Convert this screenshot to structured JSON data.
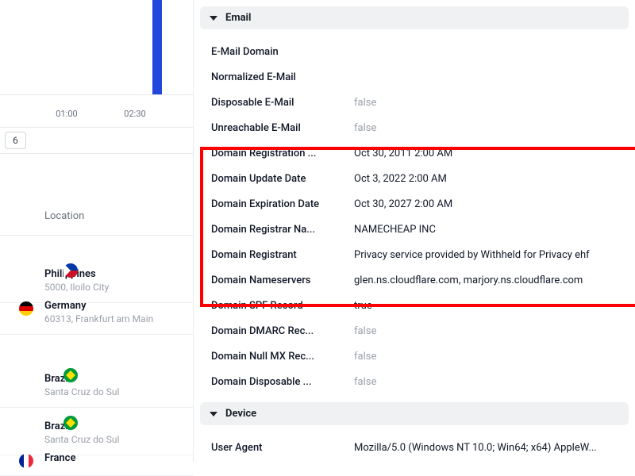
{
  "chart": {
    "timeLabels": [
      "01:00",
      "02:30"
    ],
    "badge": "6"
  },
  "leftTable": {
    "header": "Location",
    "items": [
      {
        "country": "Philippines",
        "city": "5000, Iloilo City",
        "flag": "ph"
      },
      {
        "country": "Germany",
        "city": "60313, Frankfurt am Main",
        "flag": "de"
      },
      {
        "country": "Brazil",
        "city": "Santa Cruz do Sul",
        "flag": "br"
      },
      {
        "country": "Brazil",
        "city": "Santa Cruz do Sul",
        "flag": "br"
      },
      {
        "country": "France",
        "city": "",
        "flag": "fr"
      }
    ]
  },
  "emailSection": {
    "title": "Email",
    "rows": [
      {
        "label": "E-Mail Domain",
        "value": ""
      },
      {
        "label": "Normalized E-Mail",
        "value": ""
      },
      {
        "label": "Disposable E-Mail",
        "value": "false",
        "muted": true
      },
      {
        "label": "Unreachable E-Mail",
        "value": "false",
        "muted": true
      },
      {
        "label": "Domain Registration ...",
        "value": "Oct 30, 2011 2:00 AM"
      },
      {
        "label": "Domain Update Date",
        "value": "Oct 3, 2022 2:00 AM"
      },
      {
        "label": "Domain Expiration Date",
        "value": "Oct 30, 2027 2:00 AM"
      },
      {
        "label": "Domain Registrar Na...",
        "value": "NAMECHEAP INC"
      },
      {
        "label": "Domain Registrant",
        "value": "Privacy service provided by Withheld for Privacy ehf"
      },
      {
        "label": "Domain Nameservers",
        "value": "glen.ns.cloudflare.com, marjory.ns.cloudflare.com"
      },
      {
        "label": "Domain SPF Record",
        "value": "true"
      },
      {
        "label": "Domain DMARC Rec...",
        "value": "false",
        "muted": true
      },
      {
        "label": "Domain Null MX Rec...",
        "value": "false",
        "muted": true
      },
      {
        "label": "Domain Disposable ...",
        "value": "false",
        "muted": true
      }
    ]
  },
  "deviceSection": {
    "title": "Device",
    "rows": [
      {
        "label": "User Agent",
        "value": "Mozilla/5.0 (Windows NT 10.0; Win64; x64) AppleW..."
      }
    ]
  }
}
